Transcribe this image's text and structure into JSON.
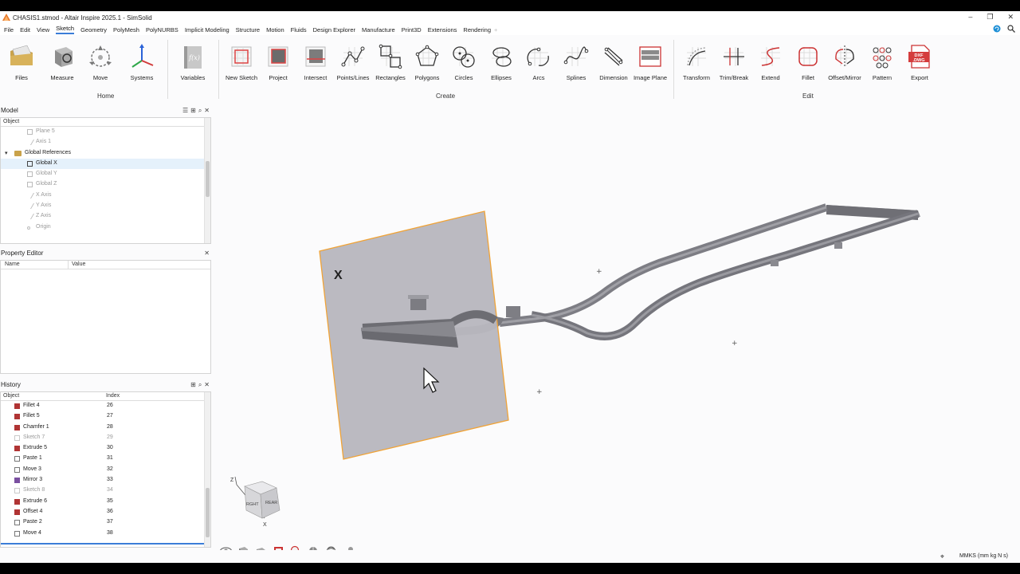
{
  "window": {
    "title": "CHASIS1.stmod - Altair Inspire 2025.1 - SimSolid",
    "controls": [
      "–",
      "❐",
      "✕"
    ]
  },
  "menu": {
    "items": [
      "File",
      "Edit",
      "View",
      "Sketch",
      "Geometry",
      "PolyMesh",
      "PolyNURBS",
      "Implicit Modeling",
      "Structure",
      "Motion",
      "Fluids",
      "Design Explorer",
      "Manufacture",
      "Print3D",
      "Extensions",
      "Rendering"
    ],
    "active": "Sketch",
    "add_symbol": "+"
  },
  "ribbon": {
    "home": {
      "group_label": "Home",
      "tools": [
        "Files",
        "Measure",
        "Move",
        "Systems"
      ]
    },
    "variables_label": "Variables",
    "variables_glyph": "f(x)",
    "create": {
      "group_label": "Create",
      "tools": [
        "New Sketch",
        "Project",
        "Intersect",
        "Points/Lines",
        "Rectangles",
        "Polygons",
        "Circles",
        "Ellipses",
        "Arcs",
        "Splines",
        "Dimension",
        "Image Plane"
      ]
    },
    "edit": {
      "group_label": "Edit",
      "tools": [
        "Transform",
        "Trim/Break",
        "Extend",
        "Fillet",
        "Offset/Mirror",
        "Pattern",
        "Export"
      ]
    },
    "export_glyph": "DXF\n.DWG"
  },
  "model_panel": {
    "title": "Model",
    "column": "Object",
    "scroll_fraction_top": 0.55,
    "items": [
      {
        "label": "Plane 5",
        "indent": 2,
        "icon": "plane",
        "state": "dim"
      },
      {
        "label": "Axis 1",
        "indent": 2,
        "icon": "axis",
        "state": "dim"
      },
      {
        "label": "Global References",
        "indent": 1,
        "icon": "folder",
        "state": "normal",
        "expanded": true
      },
      {
        "label": "Global X",
        "indent": 2,
        "icon": "plane",
        "state": "selected"
      },
      {
        "label": "Global Y",
        "indent": 2,
        "icon": "plane",
        "state": "dim"
      },
      {
        "label": "Global Z",
        "indent": 2,
        "icon": "plane",
        "state": "dim"
      },
      {
        "label": "X Axis",
        "indent": 2,
        "icon": "axis",
        "state": "dim"
      },
      {
        "label": "Y Axis",
        "indent": 2,
        "icon": "axis",
        "state": "dim"
      },
      {
        "label": "Z Axis",
        "indent": 2,
        "icon": "axis",
        "state": "dim"
      },
      {
        "label": "Origin",
        "indent": 2,
        "icon": "origin",
        "state": "dim"
      }
    ],
    "expander_symbol": "▾"
  },
  "property_editor": {
    "title": "Property Editor",
    "columns": [
      "Name",
      "Value"
    ]
  },
  "history_panel": {
    "title": "History",
    "columns": [
      "Object",
      "Index"
    ],
    "rows": [
      {
        "label": "Fillet 4",
        "index": "26",
        "icon": "feature",
        "dim": false
      },
      {
        "label": "Fillet 5",
        "index": "27",
        "icon": "feature",
        "dim": false
      },
      {
        "label": "Chamfer 1",
        "index": "28",
        "icon": "feature",
        "dim": false
      },
      {
        "label": "Sketch 7",
        "index": "29",
        "icon": "sketch",
        "dim": true
      },
      {
        "label": "Extrude 5",
        "index": "30",
        "icon": "feature",
        "dim": false
      },
      {
        "label": "Paste 1",
        "index": "31",
        "icon": "paste",
        "dim": false
      },
      {
        "label": "Move 3",
        "index": "32",
        "icon": "move",
        "dim": false
      },
      {
        "label": "Mirror 3",
        "index": "33",
        "icon": "mirror",
        "dim": false
      },
      {
        "label": "Sketch 8",
        "index": "34",
        "icon": "sketch",
        "dim": true
      },
      {
        "label": "Extrude 6",
        "index": "35",
        "icon": "feature",
        "dim": false
      },
      {
        "label": "Offset 4",
        "index": "36",
        "icon": "feature",
        "dim": false
      },
      {
        "label": "Paste 2",
        "index": "37",
        "icon": "paste",
        "dim": false
      },
      {
        "label": "Move 4",
        "index": "38",
        "icon": "move",
        "dim": false
      }
    ]
  },
  "viewport": {
    "plane_label": "X",
    "plane_color": "#b9b8bf",
    "plane_edge_color": "#f0a030",
    "frame_color": "#7a7a80",
    "view_cube": {
      "axis_z": "Z",
      "axis_x": "X",
      "faces": [
        "RGHT",
        "REAR"
      ]
    }
  },
  "status": {
    "units": "MMKS (mm kg N s)"
  },
  "colors": {
    "accent": "#3b7dd8",
    "selection": "#e5f1fb"
  }
}
